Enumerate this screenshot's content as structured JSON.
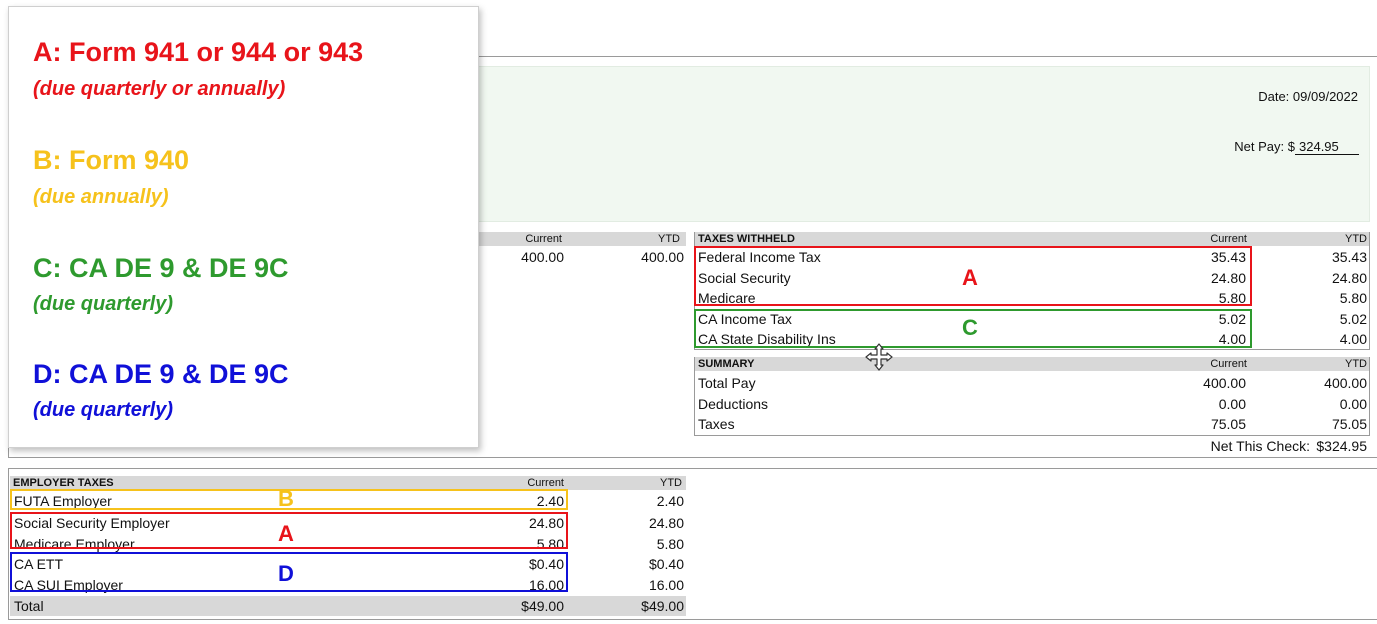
{
  "colors": {
    "a": "#e8141a",
    "b": "#f6c21c",
    "c": "#2e9a2e",
    "d": "#1010d8"
  },
  "header": {
    "date_label": "Date:",
    "date_value": "09/09/2022",
    "net_pay_label": "Net Pay: $",
    "net_pay_value": "324.95"
  },
  "earnings": {
    "col_current": "Current",
    "col_ytd": "YTD",
    "current": "400.00",
    "ytd": "400.00"
  },
  "taxes_withheld": {
    "title": "TAXES WITHHELD",
    "col_current": "Current",
    "col_ytd": "YTD",
    "rows": [
      {
        "name": "Federal Income Tax",
        "current": "35.43",
        "ytd": "35.43"
      },
      {
        "name": "Social Security",
        "current": "24.80",
        "ytd": "24.80"
      },
      {
        "name": "Medicare",
        "current": "5.80",
        "ytd": "5.80"
      },
      {
        "name": "CA Income Tax",
        "current": "5.02",
        "ytd": "5.02"
      },
      {
        "name": "CA State Disability Ins",
        "current": "4.00",
        "ytd": "4.00"
      }
    ]
  },
  "summary": {
    "title": "SUMMARY",
    "col_current": "Current",
    "col_ytd": "YTD",
    "rows": [
      {
        "name": "Total Pay",
        "current": "400.00",
        "ytd": "400.00"
      },
      {
        "name": "Deductions",
        "current": "0.00",
        "ytd": "0.00"
      },
      {
        "name": "Taxes",
        "current": "75.05",
        "ytd": "75.05"
      }
    ],
    "net_check_label": "Net This Check:",
    "net_check_value": "$324.95"
  },
  "employer_taxes": {
    "title": "EMPLOYER TAXES",
    "col_current": "Current",
    "col_ytd": "YTD",
    "rows": [
      {
        "name": "FUTA Employer",
        "current": "2.40",
        "ytd": "2.40"
      },
      {
        "name": "Social Security Employer",
        "current": "24.80",
        "ytd": "24.80"
      },
      {
        "name": "Medicare Employer",
        "current": "5.80",
        "ytd": "5.80"
      },
      {
        "name": "CA ETT",
        "current": "$0.40",
        "ytd": "$0.40"
      },
      {
        "name": "CA SUI Employer",
        "current": "16.00",
        "ytd": "16.00"
      }
    ],
    "total_label": "Total",
    "total_current": "$49.00",
    "total_ytd": "$49.00"
  },
  "annotations": {
    "a": "A",
    "b": "B",
    "c": "C",
    "d": "D"
  },
  "legend": {
    "a_title": "A: Form 941 or 944 or 943",
    "a_sub": "(due quarterly or annually)",
    "b_title": "B: Form 940",
    "b_sub": "(due annually)",
    "c_title": "C: CA DE 9 & DE 9C",
    "c_sub": "(due quarterly)",
    "d_title": "D: CA DE 9 & DE 9C",
    "d_sub": "(due quarterly)"
  },
  "icons": {
    "cursor": "move-cursor-icon"
  }
}
